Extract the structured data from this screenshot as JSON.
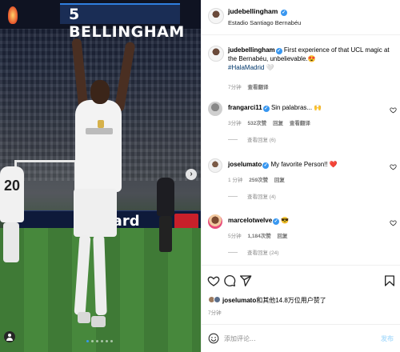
{
  "colors": {
    "accent": "#3897f0",
    "verified": "#3897f0",
    "muted": "#8e8e8e",
    "heart_red": "#ed4956",
    "post_disabled": "#b2dffc"
  },
  "photo": {
    "banner_text": "5 BELLINGHAM",
    "ad_text": "card",
    "shirt_number": "20",
    "carousel": {
      "count": 6,
      "active_index": 0
    },
    "icons": {
      "next": "chevron-right-icon",
      "tags": "person-tag-icon"
    }
  },
  "post": {
    "header": {
      "username": "judebellingham",
      "location": "Estadio Santiago Bernabéu"
    },
    "caption": {
      "username": "judebellingham",
      "text": " First experience of that UCL magic at the Bernabéu, unbelievable.😍",
      "hashtag": "#HalaMadrid",
      "emoji_after": " 🤍",
      "time": "7分钟",
      "translate": "查看翻译"
    },
    "comments": [
      {
        "username": "frangarci11",
        "verified": true,
        "text": "Sin palabras... 🙌",
        "time": "3分钟",
        "likes": "532次赞",
        "reply": "回复",
        "translate": "查看翻译",
        "replies": "查看回复 (6)"
      },
      {
        "username": "joselumato",
        "verified": true,
        "text": "My favorite Person!! ❤️",
        "time": "1 分钟",
        "likes": "259次赞",
        "reply": "回复",
        "translate": "",
        "replies": "查看回复 (4)"
      },
      {
        "username": "marcelotwelve",
        "verified": true,
        "text": "😎",
        "time": "5分钟",
        "likes": "1,184次赞",
        "reply": "回复",
        "translate": "",
        "replies": "查看回复 (24)"
      }
    ],
    "actions": {
      "like": "heart-icon",
      "comment": "comment-icon",
      "share": "share-icon",
      "save": "bookmark-icon"
    },
    "liked_by": {
      "username": "joselumato",
      "suffix": "和其他14.8万位用户赞了"
    },
    "time": "7分钟",
    "add_comment": {
      "placeholder": "添加评论...",
      "post_label": "发布"
    }
  }
}
